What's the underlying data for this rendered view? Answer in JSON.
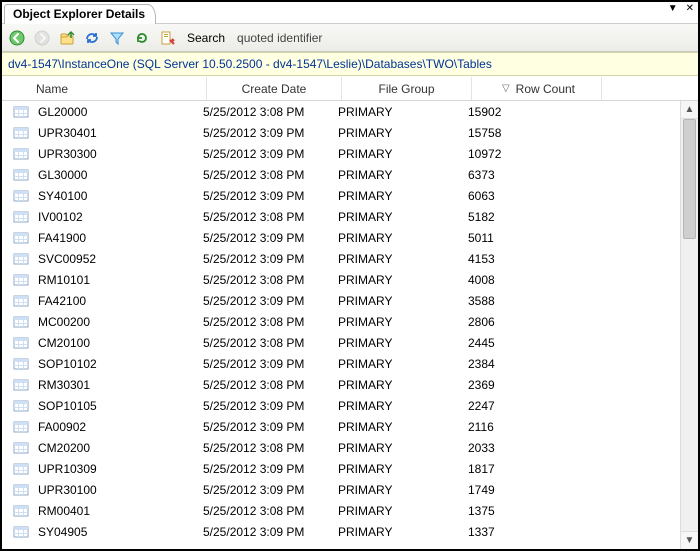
{
  "window": {
    "title": "Object Explorer Details"
  },
  "toolbar": {
    "search_label": "Search",
    "search_value": "quoted identifier"
  },
  "path": "dv4-1547\\InstanceOne (SQL Server 10.50.2500 - dv4-1547\\Leslie)\\Databases\\TWO\\Tables",
  "columns": {
    "name": "Name",
    "create_date": "Create Date",
    "file_group": "File Group",
    "row_count": "Row Count"
  },
  "rows": [
    {
      "name": "GL20000",
      "date": "5/25/2012 3:08 PM",
      "fg": "PRIMARY",
      "rc": "15902"
    },
    {
      "name": "UPR30401",
      "date": "5/25/2012 3:09 PM",
      "fg": "PRIMARY",
      "rc": "15758"
    },
    {
      "name": "UPR30300",
      "date": "5/25/2012 3:09 PM",
      "fg": "PRIMARY",
      "rc": "10972"
    },
    {
      "name": "GL30000",
      "date": "5/25/2012 3:08 PM",
      "fg": "PRIMARY",
      "rc": "6373"
    },
    {
      "name": "SY40100",
      "date": "5/25/2012 3:09 PM",
      "fg": "PRIMARY",
      "rc": "6063"
    },
    {
      "name": "IV00102",
      "date": "5/25/2012 3:08 PM",
      "fg": "PRIMARY",
      "rc": "5182"
    },
    {
      "name": "FA41900",
      "date": "5/25/2012 3:09 PM",
      "fg": "PRIMARY",
      "rc": "5011"
    },
    {
      "name": "SVC00952",
      "date": "5/25/2012 3:09 PM",
      "fg": "PRIMARY",
      "rc": "4153"
    },
    {
      "name": "RM10101",
      "date": "5/25/2012 3:08 PM",
      "fg": "PRIMARY",
      "rc": "4008"
    },
    {
      "name": "FA42100",
      "date": "5/25/2012 3:09 PM",
      "fg": "PRIMARY",
      "rc": "3588"
    },
    {
      "name": "MC00200",
      "date": "5/25/2012 3:08 PM",
      "fg": "PRIMARY",
      "rc": "2806"
    },
    {
      "name": "CM20100",
      "date": "5/25/2012 3:08 PM",
      "fg": "PRIMARY",
      "rc": "2445"
    },
    {
      "name": "SOP10102",
      "date": "5/25/2012 3:09 PM",
      "fg": "PRIMARY",
      "rc": "2384"
    },
    {
      "name": "RM30301",
      "date": "5/25/2012 3:08 PM",
      "fg": "PRIMARY",
      "rc": "2369"
    },
    {
      "name": "SOP10105",
      "date": "5/25/2012 3:09 PM",
      "fg": "PRIMARY",
      "rc": "2247"
    },
    {
      "name": "FA00902",
      "date": "5/25/2012 3:09 PM",
      "fg": "PRIMARY",
      "rc": "2116"
    },
    {
      "name": "CM20200",
      "date": "5/25/2012 3:08 PM",
      "fg": "PRIMARY",
      "rc": "2033"
    },
    {
      "name": "UPR10309",
      "date": "5/25/2012 3:09 PM",
      "fg": "PRIMARY",
      "rc": "1817"
    },
    {
      "name": "UPR30100",
      "date": "5/25/2012 3:09 PM",
      "fg": "PRIMARY",
      "rc": "1749"
    },
    {
      "name": "RM00401",
      "date": "5/25/2012 3:08 PM",
      "fg": "PRIMARY",
      "rc": "1375"
    },
    {
      "name": "SY04905",
      "date": "5/25/2012 3:09 PM",
      "fg": "PRIMARY",
      "rc": "1337"
    }
  ]
}
